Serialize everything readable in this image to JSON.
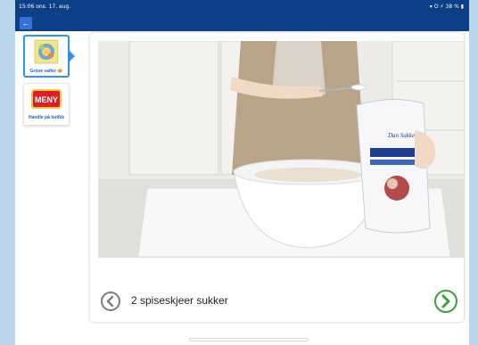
{
  "status_bar": {
    "time": "15:06  ons. 17. aug.",
    "indicators": "▾ ⭘ ⚡ 38 % ▮"
  },
  "nav": {
    "back_icon": "arrow-left-icon",
    "back_glyph": "←"
  },
  "sidebar": {
    "items": [
      {
        "label": "Grove vafler 🧇",
        "icon": "waffle-thumbnail",
        "selected": true
      },
      {
        "label": "Handle på butikk",
        "icon": "meny-logo",
        "logo_text": "MENY",
        "selected": false
      }
    ]
  },
  "step": {
    "text": "2 spiseskjeer sukker",
    "prev_icon": "chevron-left-icon",
    "next_icon": "chevron-right-icon",
    "product_brand": "Dan Sukker"
  },
  "colors": {
    "nav_blue": "#0d3f86",
    "accent_blue": "#2f93e6",
    "next_green": "#3c9e3c",
    "meny_red": "#d6202a"
  }
}
